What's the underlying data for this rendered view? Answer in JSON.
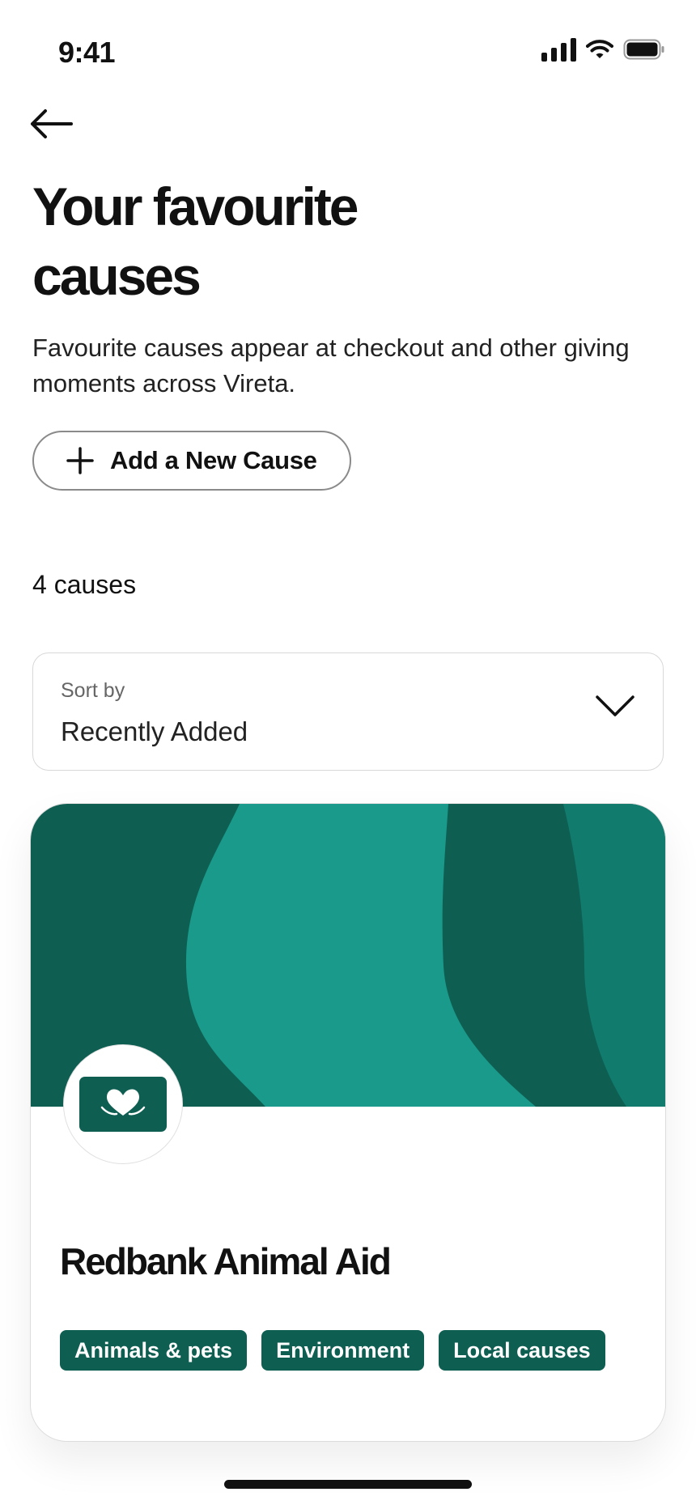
{
  "status_bar": {
    "time": "9:41",
    "icons": [
      "signal-icon",
      "wifi-icon",
      "battery-icon"
    ]
  },
  "header": {
    "back_icon": "arrow-left-icon",
    "title": "Your favourite causes",
    "subtitle": "Favourite causes appear at checkout and other giving moments across Vireta."
  },
  "actions": {
    "add_cause_icon": "plus-icon",
    "add_cause_label": "Add a New Cause"
  },
  "list": {
    "count_label": "4 causes",
    "sort": {
      "label": "Sort by",
      "value": "Recently Added",
      "icon": "chevron-down-icon"
    }
  },
  "causes": [
    {
      "name": "Redbank Animal Aid",
      "logo_icon": "heart-hands-icon",
      "tags": [
        "Animals & pets",
        "Environment",
        "Local causes"
      ]
    }
  ],
  "colors": {
    "brand_dark_green": "#0e5e52",
    "banner_teal": "#1a9a8a",
    "banner_mid": "#117b6d",
    "text": "#111111"
  }
}
